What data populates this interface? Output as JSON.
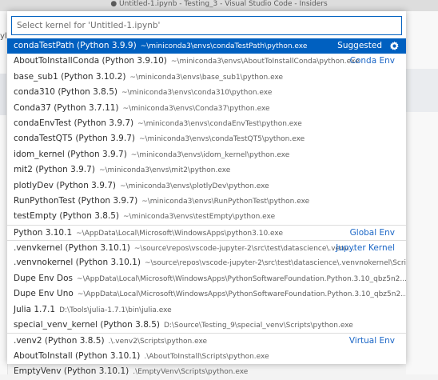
{
  "window": {
    "title": "● Untitled-1.ipynb - Testing_3 - Visual Studio Code - Insiders"
  },
  "background": {
    "left_fragment": "yl"
  },
  "search": {
    "placeholder": "Select kernel for 'Untitled-1.ipynb'",
    "value": ""
  },
  "icons": {
    "configure": "gear-icon"
  },
  "colors": {
    "accent": "#0060c0",
    "group_label": "#1a66c6",
    "focus_border": "#0060c0"
  },
  "kernels": [
    {
      "label": "condaTestPath (Python 3.9.9)",
      "description": "~\\miniconda3\\envs\\condaTestPath\\python.exe",
      "group": "Suggested",
      "selected": true
    },
    {
      "label": "AboutToInstallConda (Python 3.9.10)",
      "description": "~\\miniconda3\\envs\\AboutToInstallConda\\python.exe",
      "group": "Conda Env"
    },
    {
      "label": "base_sub1 (Python 3.10.2)",
      "description": "~\\miniconda3\\envs\\base_sub1\\python.exe"
    },
    {
      "label": "conda310 (Python 3.8.5)",
      "description": "~\\miniconda3\\envs\\conda310\\python.exe"
    },
    {
      "label": "Conda37 (Python 3.7.11)",
      "description": "~\\miniconda3\\envs\\Conda37\\python.exe"
    },
    {
      "label": "condaEnvTest (Python 3.9.7)",
      "description": "~\\miniconda3\\envs\\condaEnvTest\\python.exe"
    },
    {
      "label": "condaTestQT5 (Python 3.9.7)",
      "description": "~\\miniconda3\\envs\\condaTestQT5\\python.exe"
    },
    {
      "label": "idom_kernel (Python 3.9.7)",
      "description": "~\\miniconda3\\envs\\idom_kernel\\python.exe"
    },
    {
      "label": "mit2 (Python 3.9.7)",
      "description": "~\\miniconda3\\envs\\mit2\\python.exe"
    },
    {
      "label": "plotlyDev (Python 3.9.7)",
      "description": "~\\miniconda3\\envs\\plotlyDev\\python.exe"
    },
    {
      "label": "RunPythonTest (Python 3.9.7)",
      "description": "~\\miniconda3\\envs\\RunPythonTest\\python.exe"
    },
    {
      "label": "testEmpty (Python 3.8.5)",
      "description": "~\\miniconda3\\envs\\testEmpty\\python.exe"
    },
    {
      "label": "Python 3.10.1",
      "description": "~\\AppData\\Local\\Microsoft\\WindowsApps\\python3.10.exe",
      "group": "Global Env",
      "separator": true
    },
    {
      "label": ".venvkernel (Python 3.10.1)",
      "description": "~\\source\\repos\\vscode-jupyter-2\\src\\test\\datascience\\.venv...",
      "group": "Jupyter Kernel",
      "separator": true
    },
    {
      "label": ".venvnokernel (Python 3.10.1)",
      "description": "~\\source\\repos\\vscode-jupyter-2\\src\\test\\datascience\\.venvnokernel\\Scrip..."
    },
    {
      "label": "Dupe Env Dos",
      "description": "~\\AppData\\Local\\Microsoft\\WindowsApps\\PythonSoftwareFoundation.Python.3.10_qbz5n2..."
    },
    {
      "label": "Dupe Env Uno",
      "description": "~\\AppData\\Local\\Microsoft\\WindowsApps\\PythonSoftwareFoundation.Python.3.10_qbz5n2..."
    },
    {
      "label": "Julia 1.7.1",
      "description": "D:\\Tools\\julia-1.7.1\\bin\\julia.exe"
    },
    {
      "label": "special_venv_kernel (Python 3.8.5)",
      "description": "D:\\Source\\Testing_9\\special_venv\\Scripts\\python.exe"
    },
    {
      "label": ".venv2 (Python 3.8.5)",
      "description": ".\\.venv2\\Scripts\\python.exe",
      "group": "Virtual Env",
      "separator": true
    },
    {
      "label": "AboutToInstall (Python 3.10.1)",
      "description": ".\\AboutToInstall\\Scripts\\python.exe"
    },
    {
      "label": "EmptyVenv (Python 3.10.1)",
      "description": ".\\EmptyVenv\\Scripts\\python.exe"
    }
  ]
}
